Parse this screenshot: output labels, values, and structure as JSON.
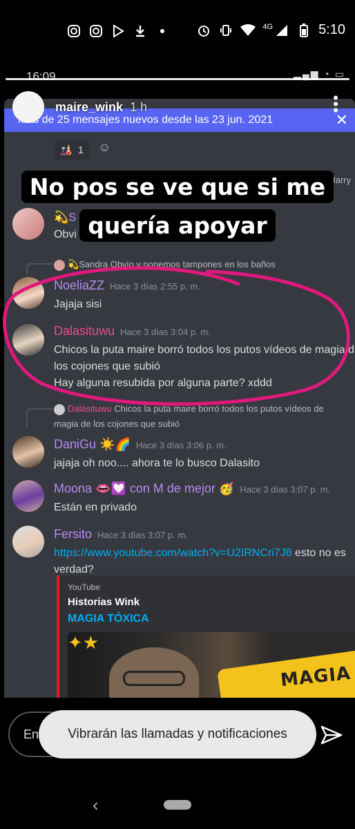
{
  "status_bar": {
    "time": "5:10",
    "network": "4G",
    "left_icons": [
      "instagram-icon",
      "instagram-icon",
      "play-store-icon",
      "download-icon",
      "dot-icon"
    ],
    "right_icons": [
      "alarm-icon",
      "vibrate-icon",
      "wifi-icon",
      "signal-icon",
      "battery-icon"
    ]
  },
  "story": {
    "username": "maire_wink",
    "age": "1 h",
    "inner_time": "16:09",
    "caption_line1": "No pos se ve que si me",
    "caption_line2": "quería apoyar",
    "circle_color": "#e0197d"
  },
  "discord": {
    "banner": "Más de 25 mensajes nuevos desde las 23 jun. 2021",
    "reaction_count": "1",
    "partial_name_right": "Harry",
    "partial_user": "S",
    "partial_text": "Obvi",
    "messages": [
      {
        "reply": "Sandra  Obvio y ponemos tampones en los baños",
        "user": "NoeliaZZ",
        "color": "#b68cf3",
        "time": "Hace 3 días 2:55 p. m.",
        "text": "Jajaja  sisi"
      },
      {
        "user": "Dalasituwu",
        "color": "#e94f8a",
        "time": "Hace 3 días 3:04 p. m.",
        "text": "Chicos la puta maire borró todos los putos vídeos de magia d los cojones que subió",
        "text2": "Hay alguna resubida por alguna parte? xddd"
      },
      {
        "reply_user": "Dalasituwu",
        "reply": "Chicos la puta maire borró todos los putos vídeos de",
        "reply2": "magia de los cojones que subió",
        "user": "DaniGu ☀️🌈",
        "color": "#b68cf3",
        "time": "Hace 3 días 3:06 p. m.",
        "text": "jajaja oh noo.... ahora te lo busco Dalasito"
      },
      {
        "user": "Moona 👄💟 con M de mejor 🥳",
        "color": "#b68cf3",
        "time": "Hace 3 días 3:07 p. m.",
        "text": "Están en privado"
      },
      {
        "user": "Fersito",
        "color": "#b68cf3",
        "time": "Hace 3 días 3:07 p. m.",
        "link": "https://www.youtube.com/watch?v=U2IRNCri7J8",
        "text_after": " esto no es",
        "text2": "verdad?"
      }
    ],
    "embed": {
      "provider": "YouTube",
      "author": "Historias Wink",
      "title": "MAGIA TÓXICA",
      "thumb_text": "MAGIA"
    }
  },
  "bottom": {
    "reply_placeholder": "Enviar mensaje",
    "toast": "Vibrarán las llamadas y notificaciones"
  }
}
